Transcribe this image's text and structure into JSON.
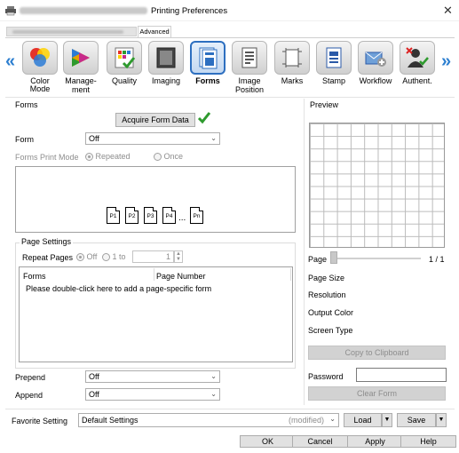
{
  "window": {
    "title": "Printing Preferences",
    "close_glyph": "✕"
  },
  "tabs": {
    "advanced": "Advanced"
  },
  "toolbar": {
    "items": [
      {
        "label": "Color Mode",
        "icon": "color-mode-icon"
      },
      {
        "label": "Manage-ment",
        "icon": "management-icon"
      },
      {
        "label": "Quality",
        "icon": "quality-icon"
      },
      {
        "label": "Imaging",
        "icon": "imaging-icon"
      },
      {
        "label": "Forms",
        "icon": "forms-icon"
      },
      {
        "label": "Image Position",
        "icon": "image-position-icon"
      },
      {
        "label": "Marks",
        "icon": "marks-icon"
      },
      {
        "label": "Stamp",
        "icon": "stamp-icon"
      },
      {
        "label": "Workflow",
        "icon": "workflow-icon"
      },
      {
        "label": "Authent.",
        "icon": "authentication-icon"
      }
    ],
    "label_line1": [
      "Color Mode",
      "Manage-",
      "Quality",
      "Imaging",
      "Forms",
      "Image",
      "Marks",
      "Stamp",
      "Workflow",
      "Authent."
    ],
    "label_line2": [
      "",
      "ment",
      "",
      "",
      "",
      "Position",
      "",
      "",
      "",
      ""
    ]
  },
  "forms": {
    "group_title": "Forms",
    "acquire_button": "Acquire Form Data",
    "form_label": "Form",
    "form_value": "Off",
    "print_mode_label": "Forms Print Mode",
    "repeated_label": "Repeated",
    "once_label": "Once",
    "pages": [
      "P1",
      "P2",
      "P3",
      "P4",
      "Pn"
    ],
    "ellipsis": "..."
  },
  "page_settings": {
    "group_title": "Page Settings",
    "repeat_label": "Repeat Pages",
    "off_label": "Off",
    "range_label": "1 to",
    "range_value": "1",
    "col_forms": "Forms",
    "col_page_number": "Page Number",
    "hint": "Please double-click here to add a page-specific form"
  },
  "prepend": {
    "label": "Prepend",
    "value": "Off"
  },
  "append": {
    "label": "Append",
    "value": "Off"
  },
  "preview": {
    "group_title": "Preview",
    "page_label": "Page",
    "page_count": "1 / 1",
    "info": [
      "Page Size",
      "Resolution",
      "Output Color",
      "Screen Type"
    ],
    "copy_button": "Copy to Clipboard",
    "password_label": "Password",
    "clear_button": "Clear Form"
  },
  "favorite": {
    "label": "Favorite Setting",
    "value": "Default Settings",
    "modified": "(modified)",
    "load_button": "Load",
    "save_button": "Save"
  },
  "footer": {
    "ok": "OK",
    "cancel": "Cancel",
    "apply": "Apply",
    "help": "Help"
  },
  "colors": {
    "accent": "#2d6fc0",
    "check": "#2e9a2e"
  }
}
